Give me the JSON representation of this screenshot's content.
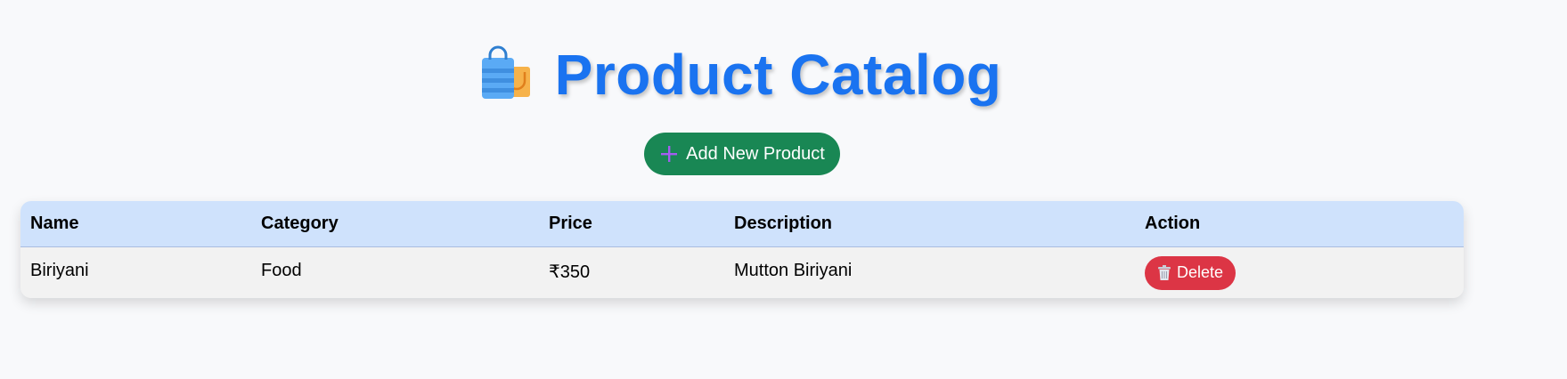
{
  "header": {
    "icon": "shopping-bags-icon",
    "title": "Product Catalog"
  },
  "toolbar": {
    "add_label": "Add New Product",
    "add_icon": "plus-icon"
  },
  "table": {
    "columns": [
      "Name",
      "Category",
      "Price",
      "Description",
      "Action"
    ],
    "rows": [
      {
        "name": "Biriyani",
        "category": "Food",
        "price": "₹350",
        "description": "Mutton Biriyani",
        "action_label": "Delete",
        "action_icon": "trash-icon"
      }
    ]
  },
  "colors": {
    "title": "#1a73f0",
    "add_button": "#198754",
    "delete_button": "#dc3545",
    "table_header": "#cfe2fc",
    "page_background": "#f8f9fb"
  }
}
